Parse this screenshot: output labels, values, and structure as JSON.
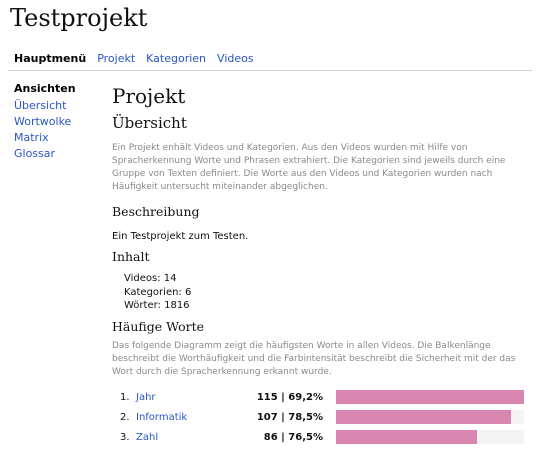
{
  "site": {
    "title": "Testprojekt"
  },
  "topnav": [
    {
      "label": "Hauptmenü",
      "active": true
    },
    {
      "label": "Projekt",
      "active": false
    },
    {
      "label": "Kategorien",
      "active": false
    },
    {
      "label": "Videos",
      "active": false
    }
  ],
  "sidebar": {
    "heading": "Ansichten",
    "items": [
      {
        "label": "Übersicht"
      },
      {
        "label": "Wortwolke"
      },
      {
        "label": "Matrix"
      },
      {
        "label": "Glossar"
      }
    ]
  },
  "main": {
    "title": "Projekt",
    "section_title": "Übersicht",
    "intro": "Ein Projekt enhält Videos und Kategorien. Aus den Videos wurden mit Hilfe von Spracherkennung Worte und Phrasen extrahiert. Die Kategorien sind jeweils durch eine Gruppe von Texten definiert. Die Worte aus den Videos und Kategorien wurden nach Häufigkeit untersucht miteinander abgeglichen.",
    "description": {
      "heading": "Beschreibung",
      "text": "Ein Testprojekt zum Testen."
    },
    "content": {
      "heading": "Inhalt",
      "videos": "Videos: 14",
      "categories": "Kategorien: 6",
      "words": "Wörter: 1816"
    },
    "frequent": {
      "heading": "Häufige Worte",
      "text": "Das folgende Diagramm zeigt die häufigsten Worte in allen Videos. Die Balkenlänge beschreibt die Worthäufigkeit und die Farbintensität beschreibt die Sicherheit mit der das Wort durch die Spracherkennung erkannt wurde."
    }
  },
  "chart_data": {
    "type": "bar",
    "categories": [
      "Jahr",
      "Informatik",
      "Zahl"
    ],
    "ranks": [
      "1.",
      "2.",
      "3."
    ],
    "values": [
      115,
      107,
      86
    ],
    "confidence": [
      69.2,
      78.5,
      76.5
    ],
    "labels": [
      "115 | 69,2%",
      "107 | 78,5%",
      "86 | 76,5%"
    ],
    "xlim": [
      0,
      115
    ],
    "color": "#d987b0"
  }
}
